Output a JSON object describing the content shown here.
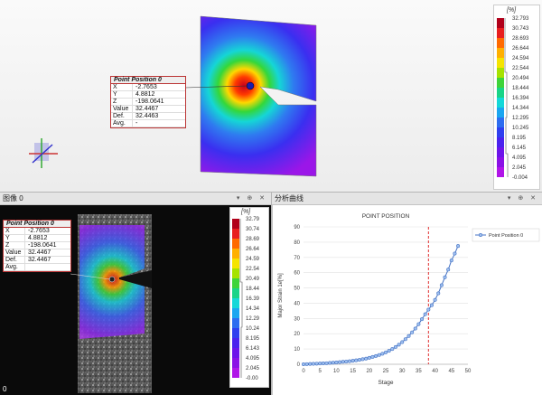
{
  "point_box_top": {
    "title": "Point Position 0",
    "rows": [
      {
        "k": "X",
        "v": "-2.7653"
      },
      {
        "k": "Y",
        "v": "4.8812"
      },
      {
        "k": "Z",
        "v": "-198.0641"
      },
      {
        "k": "Value",
        "v": "32.4467"
      },
      {
        "k": "Def.",
        "v": "32.4463"
      },
      {
        "k": "Avg.",
        "v": "-"
      }
    ]
  },
  "legend_top": {
    "unit": "[%]",
    "ticks": [
      "32.793",
      "30.743",
      "28.693",
      "26.644",
      "24.594",
      "22.544",
      "20.494",
      "18.444",
      "16.394",
      "14.344",
      "12.295",
      "10.245",
      "8.195",
      "6.145",
      "4.095",
      "2.045",
      "-0.004"
    ]
  },
  "panel_image": {
    "title": "图像 0",
    "controls": "▾ ⊕ ✕",
    "frame": "0"
  },
  "panel_chart": {
    "title": "分析曲线",
    "controls": "▾ ⊕ ✕"
  },
  "point_box_img": {
    "title": "Point Position 0",
    "rows": [
      {
        "k": "X",
        "v": "-2.7653"
      },
      {
        "k": "Y",
        "v": "4.8812"
      },
      {
        "k": "Z",
        "v": "-198.0641"
      },
      {
        "k": "Value",
        "v": "32.4467"
      },
      {
        "k": "Def.",
        "v": "32.4467"
      },
      {
        "k": "Avg.",
        "v": ""
      }
    ]
  },
  "legend_img": {
    "unit": "[%]",
    "ticks": [
      "32.79",
      "30.74",
      "28.69",
      "26.64",
      "24.59",
      "22.54",
      "20.49",
      "18.44",
      "16.39",
      "14.34",
      "12.29",
      "10.24",
      "8.195",
      "6.143",
      "4.095",
      "2.045",
      "-0.00"
    ]
  },
  "colors": {
    "accent_red": "#cc2222",
    "series": "#4472c4",
    "marker_line": "#e03030"
  },
  "chart_data": {
    "type": "line",
    "title": "POINT POSITION",
    "xlabel": "Stage",
    "ylabel": "Major Strain 1e[%]",
    "xlim": [
      0,
      50
    ],
    "ylim": [
      0,
      90
    ],
    "xticks": [
      0,
      5,
      10,
      15,
      20,
      25,
      30,
      35,
      40,
      45,
      50
    ],
    "yticks": [
      0,
      10,
      20,
      30,
      40,
      50,
      60,
      70,
      80,
      90
    ],
    "grid": true,
    "legend_position": "top-right",
    "vline_x": 38,
    "series": [
      {
        "name": "Point Position 0",
        "x": [
          0,
          1,
          2,
          3,
          4,
          5,
          6,
          7,
          8,
          9,
          10,
          11,
          12,
          13,
          14,
          15,
          16,
          17,
          18,
          19,
          20,
          21,
          22,
          23,
          24,
          25,
          26,
          27,
          28,
          29,
          30,
          31,
          32,
          33,
          34,
          35,
          36,
          37,
          38,
          39,
          40,
          41,
          42,
          43,
          44,
          45,
          46,
          47
        ],
        "y": [
          0,
          0.1,
          0.2,
          0.3,
          0.4,
          0.5,
          0.6,
          0.7,
          0.9,
          1.0,
          1.2,
          1.4,
          1.6,
          1.8,
          2.0,
          2.3,
          2.6,
          2.9,
          3.3,
          3.7,
          4.2,
          4.8,
          5.4,
          6.1,
          6.9,
          7.8,
          8.8,
          10.0,
          11.3,
          12.8,
          14.5,
          16.4,
          18.5,
          20.9,
          23.4,
          26.3,
          29.5,
          32.8,
          35.8,
          38.7,
          42.2,
          46.5,
          51.8,
          57.0,
          62.0,
          68.0,
          72.5,
          77.5
        ]
      }
    ]
  }
}
